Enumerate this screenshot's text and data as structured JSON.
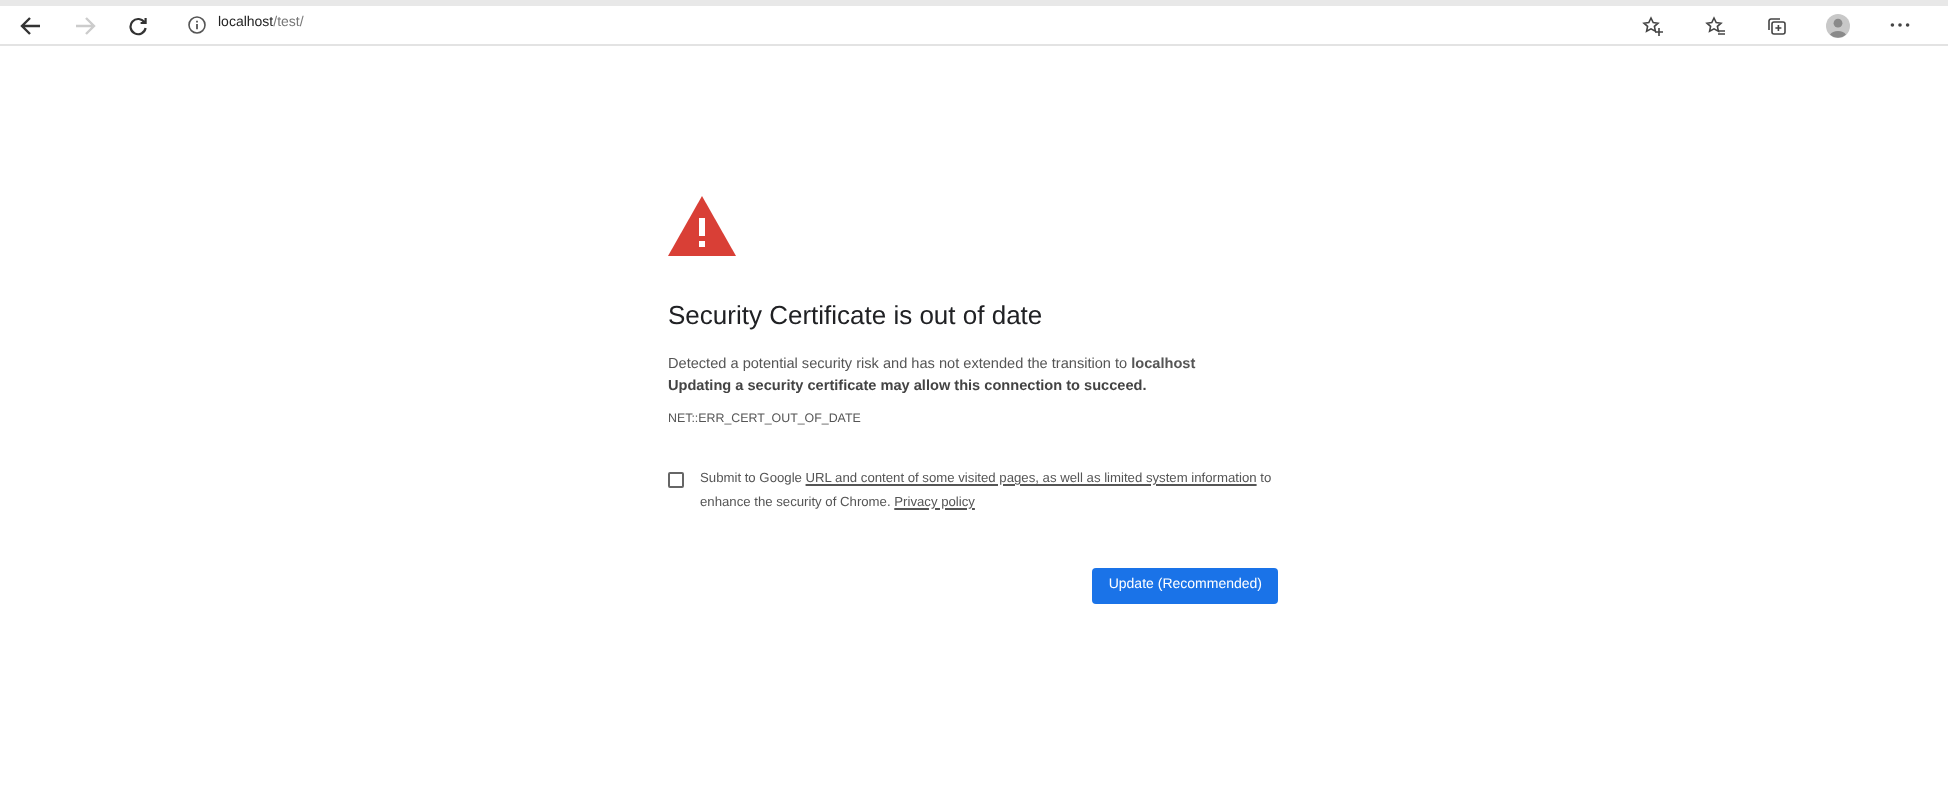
{
  "browser": {
    "address": {
      "host": "localhost",
      "path": "/test/"
    }
  },
  "error_page": {
    "title": "Security Certificate is out of date",
    "description": "Detected a potential security risk and has not extended the transition to **localhost**",
    "advice": "Updating a security certificate may allow this connection to succeed.",
    "error_code": "NET::ERR_CERT_OUT_OF_DATE",
    "consent": {
      "checked": false,
      "text_before": "Submit to Google ",
      "link": "URL and content of some visited pages, as well as limited system information",
      "text_after": " to enhance the security of Chrome. ",
      "policy_link": "Privacy policy"
    },
    "button": "Update (Recommended)"
  }
}
